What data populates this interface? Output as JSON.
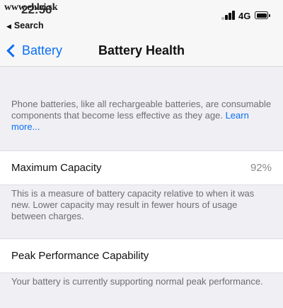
{
  "status_bar": {
    "watermark": "www.ehlei.sk",
    "time": "22:56",
    "back_app": "Search",
    "network": "4G",
    "signal_icon": "signal-bars-icon",
    "battery_icon": "battery-icon"
  },
  "nav": {
    "back_label": "Battery",
    "title": "Battery Health"
  },
  "intro": {
    "text": "Phone batteries, like all rechargeable batteries, are consumable components that become less effective as they age. ",
    "link": "Learn more..."
  },
  "max_capacity": {
    "label": "Maximum Capacity",
    "value": "92%",
    "description": "This is a measure of battery capacity relative to when it was new. Lower capacity may result in fewer hours of usage between charges."
  },
  "peak_performance": {
    "label": "Peak Performance Capability",
    "description": "Your battery is currently supporting normal peak performance."
  },
  "colors": {
    "accent": "#0a6ff5",
    "background": "#efeff4",
    "secondary_text": "#6d6d72"
  }
}
